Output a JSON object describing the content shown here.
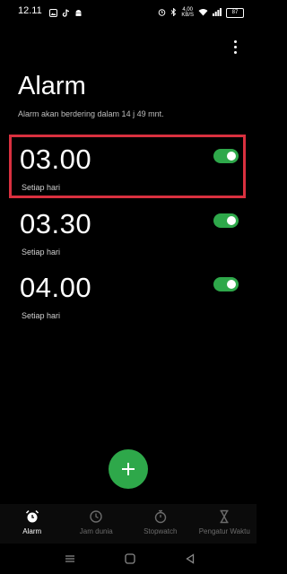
{
  "status_bar": {
    "time": "12.11",
    "network_speed": "4,00\nKB/S",
    "battery": "87"
  },
  "header": {
    "title": "Alarm",
    "subtitle": "Alarm akan berdering dalam 14 j 49 mnt."
  },
  "alarms": [
    {
      "time": "03.00",
      "repeat": "Setiap hari",
      "enabled": true
    },
    {
      "time": "03.30",
      "repeat": "Setiap hari",
      "enabled": true
    },
    {
      "time": "04.00",
      "repeat": "Setiap hari",
      "enabled": true
    }
  ],
  "bottom_nav": [
    {
      "label": "Alarm",
      "icon": "alarm-clock-icon",
      "active": true
    },
    {
      "label": "Jam dunia",
      "icon": "world-clock-icon",
      "active": false
    },
    {
      "label": "Stopwatch",
      "icon": "stopwatch-icon",
      "active": false
    },
    {
      "label": "Pengatur Waktu",
      "icon": "hourglass-icon",
      "active": false
    }
  ],
  "colors": {
    "accent": "#2ea84a",
    "highlight": "#d9303f",
    "background": "#000000"
  }
}
